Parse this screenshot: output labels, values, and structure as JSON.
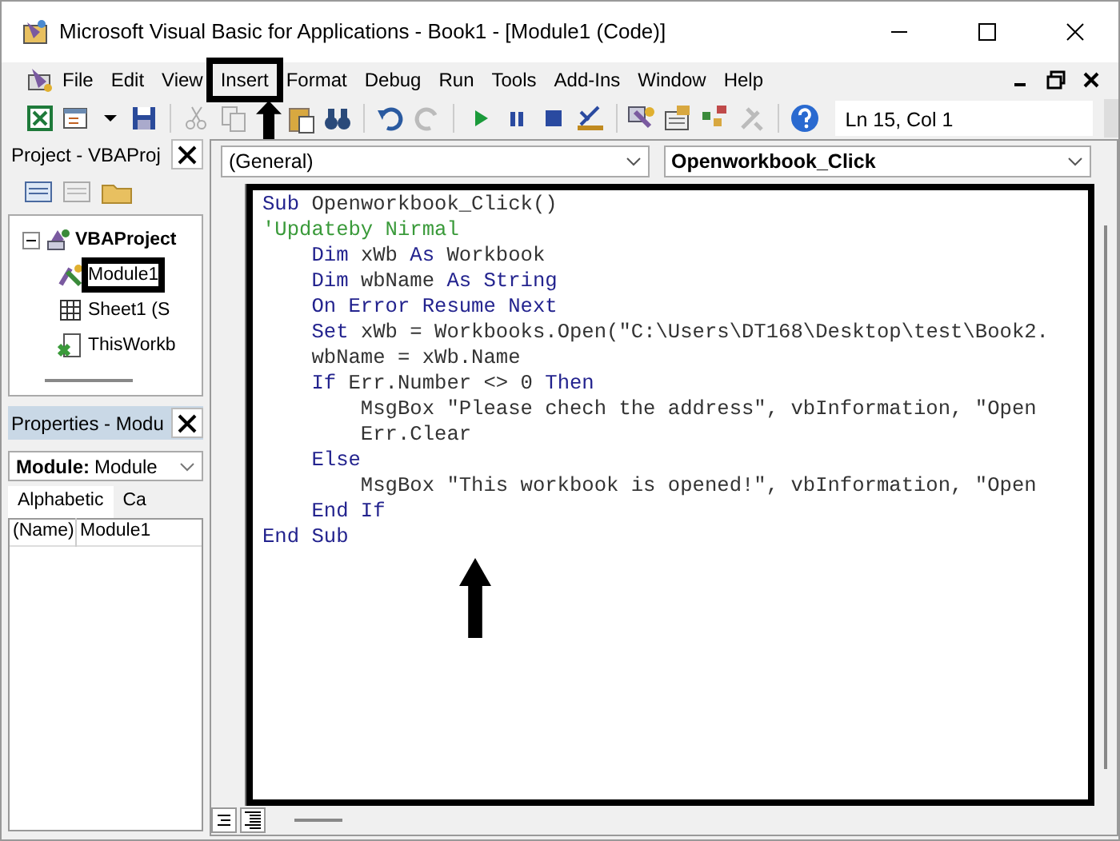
{
  "window": {
    "title": "Microsoft Visual Basic for Applications - Book1 - [Module1 (Code)]"
  },
  "menu": [
    {
      "label": "File"
    },
    {
      "label": "Edit"
    },
    {
      "label": "View"
    },
    {
      "label": "Insert"
    },
    {
      "label": "Format"
    },
    {
      "label": "Debug"
    },
    {
      "label": "Run"
    },
    {
      "label": "Tools"
    },
    {
      "label": "Add-Ins"
    },
    {
      "label": "Window"
    },
    {
      "label": "Help"
    }
  ],
  "toolbar": {
    "position": "Ln 15, Col 1"
  },
  "project_explorer": {
    "title": "Project - VBAProj",
    "tree": [
      {
        "label": "VBAProject",
        "kind": "project",
        "expanded": true,
        "children": [
          {
            "label": "Module1",
            "kind": "module"
          },
          {
            "label": "Sheet1 (S",
            "kind": "sheet"
          },
          {
            "label": "ThisWorkb",
            "kind": "workbook"
          }
        ]
      }
    ]
  },
  "properties": {
    "title": "Properties - Modu",
    "object_name": "Module:",
    "object_type": "Module",
    "tabs": [
      {
        "label": "Alphabetic",
        "selected": true
      },
      {
        "label": "Ca",
        "selected": false
      }
    ],
    "rows": [
      {
        "name": "(Name)",
        "value": "Module1"
      }
    ]
  },
  "code_window": {
    "object": "(General)",
    "procedure": "Openworkbook_Click",
    "lines": [
      [
        {
          "kind": "keyword",
          "text": "Sub"
        },
        {
          "kind": "text",
          "text": " Openworkbook_Click()"
        }
      ],
      [
        {
          "kind": "comment",
          "text": "'Updateby Nirmal"
        }
      ],
      [
        {
          "kind": "keyword",
          "text": "    Dim"
        },
        {
          "kind": "text",
          "text": " xWb "
        },
        {
          "kind": "keyword",
          "text": "As"
        },
        {
          "kind": "text",
          "text": " Workbook"
        }
      ],
      [
        {
          "kind": "keyword",
          "text": "    Dim"
        },
        {
          "kind": "text",
          "text": " wbName "
        },
        {
          "kind": "keyword",
          "text": "As String"
        }
      ],
      [
        {
          "kind": "keyword",
          "text": "    On Error Resume Next"
        }
      ],
      [
        {
          "kind": "keyword",
          "text": "    Set"
        },
        {
          "kind": "text",
          "text": " xWb = Workbooks.Open(\"C:\\Users\\DT168\\Desktop\\test\\Book2."
        }
      ],
      [
        {
          "kind": "text",
          "text": "    wbName = xWb.Name"
        }
      ],
      [
        {
          "kind": "keyword",
          "text": "    If"
        },
        {
          "kind": "text",
          "text": " Err.Number <> 0 "
        },
        {
          "kind": "keyword",
          "text": "Then"
        }
      ],
      [
        {
          "kind": "text",
          "text": "        MsgBox \"Please chech the address\", vbInformation, \"Open"
        }
      ],
      [
        {
          "kind": "text",
          "text": "        Err.Clear"
        }
      ],
      [
        {
          "kind": "keyword",
          "text": "    Else"
        }
      ],
      [
        {
          "kind": "text",
          "text": "        MsgBox \"This workbook is opened!\", vbInformation, \"Open"
        }
      ],
      [
        {
          "kind": "keyword",
          "text": "    End If"
        }
      ],
      [
        {
          "kind": "keyword",
          "text": "End Sub"
        }
      ]
    ]
  }
}
